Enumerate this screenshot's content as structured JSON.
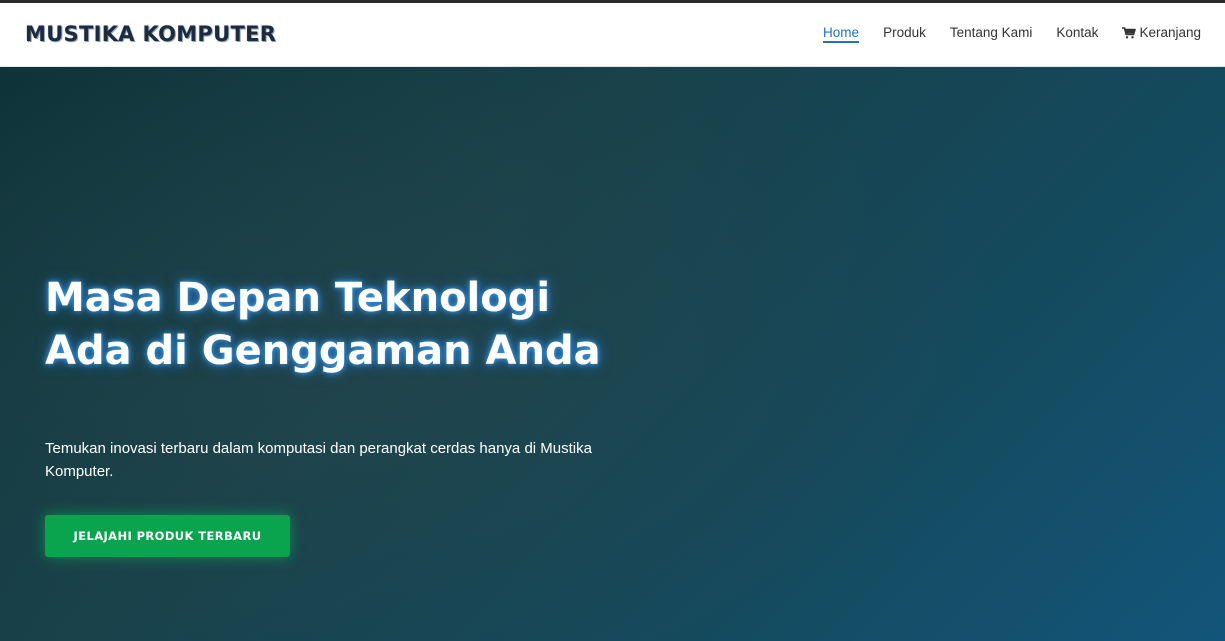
{
  "brand": {
    "name": "MUSTIKA KOMPUTER"
  },
  "nav": {
    "items": [
      {
        "label": "Home",
        "active": true
      },
      {
        "label": "Produk",
        "active": false
      },
      {
        "label": "Tentang Kami",
        "active": false
      },
      {
        "label": "Kontak",
        "active": false
      },
      {
        "label": "Keranjang",
        "active": false,
        "icon": "cart-icon"
      }
    ]
  },
  "hero": {
    "title": "Masa Depan Teknologi Ada di Genggaman Anda",
    "subtitle": "Temukan inovasi terbaru dalam komputasi dan perangkat cerdas hanya di Mustika Komputer.",
    "cta_label": "JELAJAHI PRODUK TERBARU"
  },
  "colors": {
    "accent": "#1a74c9",
    "cta": "#0aa34e",
    "hero_start": "#0d3338",
    "hero_end": "#13557a"
  }
}
